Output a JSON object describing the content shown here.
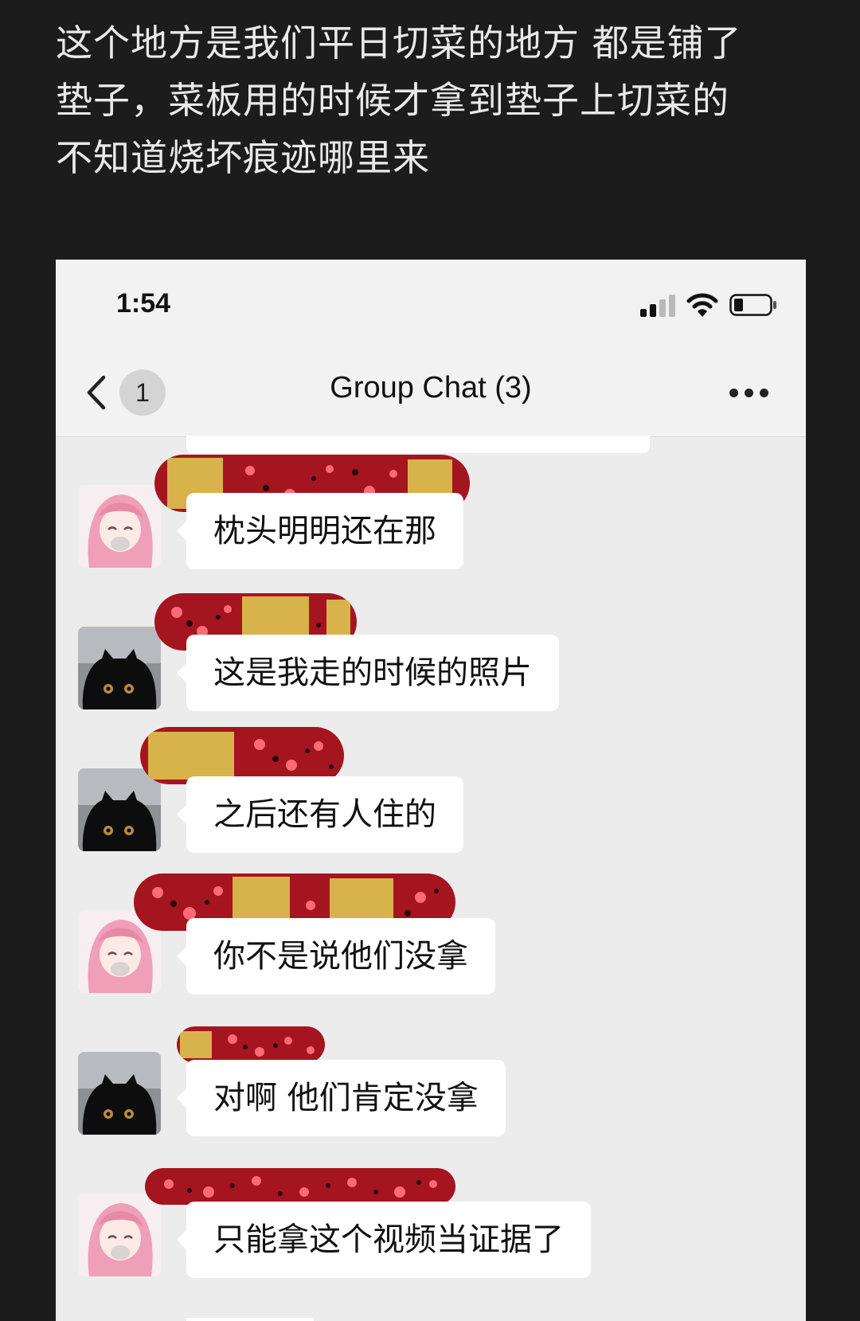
{
  "caption": {
    "lines": [
      "这个地方是我们平日切菜的地方 都是铺了",
      "垫子，菜板用的时候才拿到垫子上切菜的",
      "不知道烧坏痕迹哪里来"
    ]
  },
  "status_bar": {
    "time": "1:54"
  },
  "navbar": {
    "unread_count": "1",
    "title": "Group Chat (3)"
  },
  "messages": [
    {
      "sender_avatar": "pink-hair-anime-avatar",
      "text": "枕头明明还在那"
    },
    {
      "sender_avatar": "black-cat-avatar",
      "text": "这是我走的时候的照片"
    },
    {
      "sender_avatar": "black-cat-avatar",
      "text": "之后还有人住的"
    },
    {
      "sender_avatar": "pink-hair-anime-avatar",
      "text": "你不是说他们没拿"
    },
    {
      "sender_avatar": "black-cat-avatar",
      "text": "对啊 他们肯定没拿"
    },
    {
      "sender_avatar": "pink-hair-anime-avatar",
      "text": "只能拿这个视频当证据了"
    }
  ],
  "colors": {
    "background": "#1c1c1c",
    "caption_text": "#e9e9e9",
    "chat_background": "#ececec",
    "bubble": "#ffffff",
    "redaction_red": "#b01c2a",
    "redaction_gold": "#d8b24a"
  }
}
